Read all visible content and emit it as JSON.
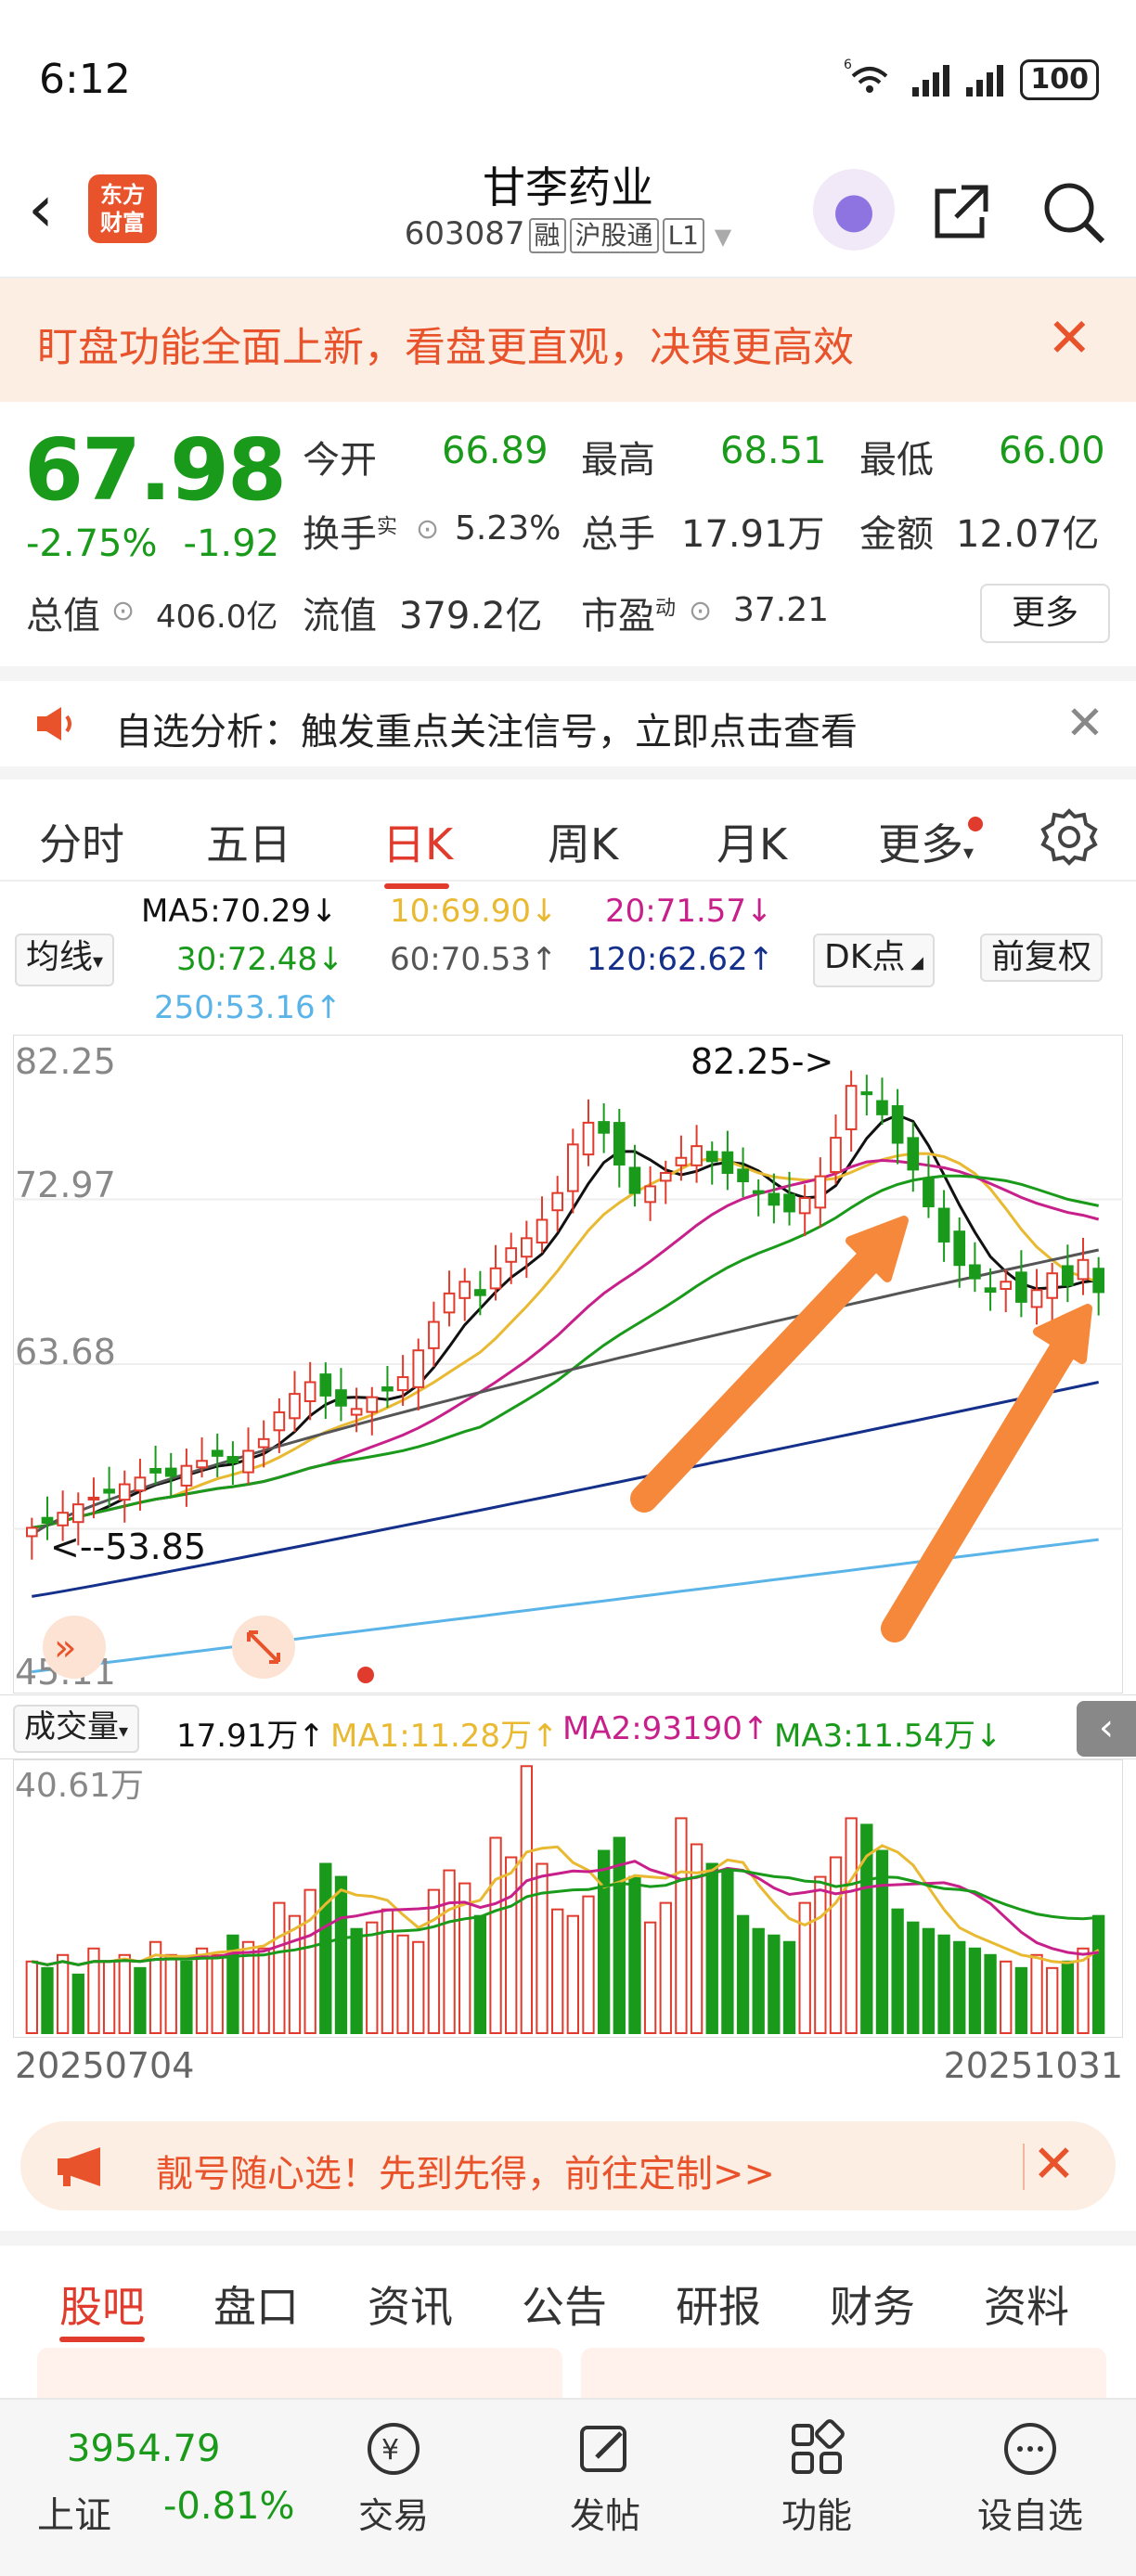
{
  "status_bar": {
    "time": "6:12",
    "battery": "100",
    "signal_label": "6"
  },
  "header": {
    "logo_line1": "东方",
    "logo_line2": "财富",
    "stock_name": "甘李药业",
    "stock_code": "603087",
    "tags": [
      "融",
      "沪股通",
      "L1"
    ]
  },
  "notice": {
    "text": "盯盘功能全面上新，看盘更直观，决策更高效"
  },
  "quote": {
    "price": "67.98",
    "change_pct": "-2.75%",
    "change_amt": "-1.92",
    "open_label": "今开",
    "open": "66.89",
    "high_label": "最高",
    "high": "68.51",
    "low_label": "最低",
    "low": "66.00",
    "turnover_label": "换手",
    "turnover_sup": "实",
    "turnover": "5.23%",
    "volume_label": "总手",
    "volume": "17.91万",
    "amount_label": "金额",
    "amount": "12.07亿",
    "mcap_label": "总值",
    "mcap": "406.0亿",
    "float_label": "流值",
    "float_cap": "379.2亿",
    "pe_label": "市盈",
    "pe_sup": "动",
    "pe": "37.21",
    "more_label": "更多"
  },
  "alert": {
    "text": "自选分析：触发重点关注信号，立即点击查看"
  },
  "tabs": [
    "分时",
    "五日",
    "日K",
    "周K",
    "月K",
    "更多"
  ],
  "active_tab": "日K",
  "ma_legend": {
    "selector_label": "均线",
    "ma5": "MA5:70.29↓",
    "ma10": "10:69.90↓",
    "ma20": "20:71.57↓",
    "ma30": "30:72.48↓",
    "ma60": "60:70.53↑",
    "ma120": "120:62.62↑",
    "ma250": "250:53.16↑",
    "dk_label": "DK点",
    "adjust_label": "前复权"
  },
  "colors": {
    "up": "#e03b2c",
    "down": "#1a9a1a",
    "ma5": "#111111",
    "ma10": "#e8b931",
    "ma20": "#c8208a",
    "ma30": "#1a9a1a",
    "ma60": "#555555",
    "ma120": "#14308a",
    "ma250": "#5ab4e8",
    "arrow": "#f5883a"
  },
  "chart_data": {
    "type": "candlestick",
    "y_ticks": [
      "82.25",
      "72.97",
      "63.68",
      "45.11"
    ],
    "ylim": [
      45.11,
      82.25
    ],
    "annotations": {
      "high_marker": "82.25->",
      "low_marker": "<--53.85"
    },
    "x_start": "20250704",
    "x_end": "20251031",
    "closes": [
      53.9,
      54.2,
      54.8,
      55.3,
      55.7,
      56.0,
      56.5,
      56.9,
      57.2,
      57.0,
      57.6,
      57.9,
      58.2,
      57.8,
      58.5,
      59.2,
      60.8,
      61.9,
      62.6,
      61.8,
      61.2,
      61.0,
      61.7,
      62.1,
      62.9,
      64.5,
      66.2,
      67.9,
      68.6,
      67.8,
      69.4,
      70.6,
      71.2,
      72.3,
      73.9,
      76.8,
      78.1,
      77.5,
      75.6,
      73.9,
      74.3,
      75.1,
      76.0,
      76.7,
      75.8,
      75.1,
      74.6,
      73.9,
      73.2,
      72.8,
      73.6,
      74.9,
      77.2,
      80.3,
      79.8,
      78.6,
      76.9,
      75.3,
      73.1,
      71.0,
      69.6,
      68.8,
      68.0,
      68.6,
      67.4,
      68.1,
      69.1,
      68.4,
      69.9,
      67.98
    ],
    "volume": {
      "label": "成交量",
      "value": "17.91万↑",
      "ma1": "MA1:11.28万↑",
      "ma2": "MA2:93190↑",
      "ma3": "MA3:11.54万↓",
      "y_tick": "40.61万",
      "max": 40.61,
      "values": [
        11,
        10,
        12,
        9,
        13,
        11,
        12,
        10,
        14,
        12,
        11,
        13,
        12,
        15,
        14,
        13,
        20,
        18,
        22,
        26,
        24,
        16,
        17,
        19,
        15,
        14,
        22,
        25,
        23,
        18,
        30,
        27,
        41,
        26,
        19,
        18,
        21,
        28,
        30,
        24,
        17,
        20,
        33,
        29,
        26,
        25,
        18,
        16,
        15,
        14,
        20,
        24,
        27,
        33,
        32,
        28,
        19,
        17,
        16,
        15,
        14,
        13,
        12,
        11,
        10,
        12,
        10,
        11,
        13,
        18
      ],
      "up_flags": [
        1,
        0,
        1,
        0,
        1,
        1,
        1,
        0,
        1,
        1,
        0,
        1,
        1,
        0,
        1,
        1,
        1,
        1,
        1,
        0,
        0,
        0,
        1,
        1,
        1,
        1,
        1,
        1,
        1,
        0,
        1,
        1,
        1,
        1,
        1,
        1,
        1,
        0,
        0,
        0,
        1,
        1,
        1,
        1,
        0,
        0,
        0,
        0,
        0,
        0,
        1,
        1,
        1,
        1,
        0,
        0,
        0,
        0,
        0,
        0,
        0,
        0,
        0,
        1,
        0,
        1,
        1,
        0,
        1,
        0
      ]
    }
  },
  "promo": {
    "text": "靓号随心选！先到先得，前往定制>>"
  },
  "bottom_tabs": [
    "股吧",
    "盘口",
    "资讯",
    "公告",
    "研报",
    "财务",
    "资料"
  ],
  "bottom_nav": {
    "index_value": "3954.79",
    "index_name": "上证",
    "index_change": "-0.81%",
    "items": [
      "交易",
      "发帖",
      "功能",
      "设自选"
    ]
  }
}
